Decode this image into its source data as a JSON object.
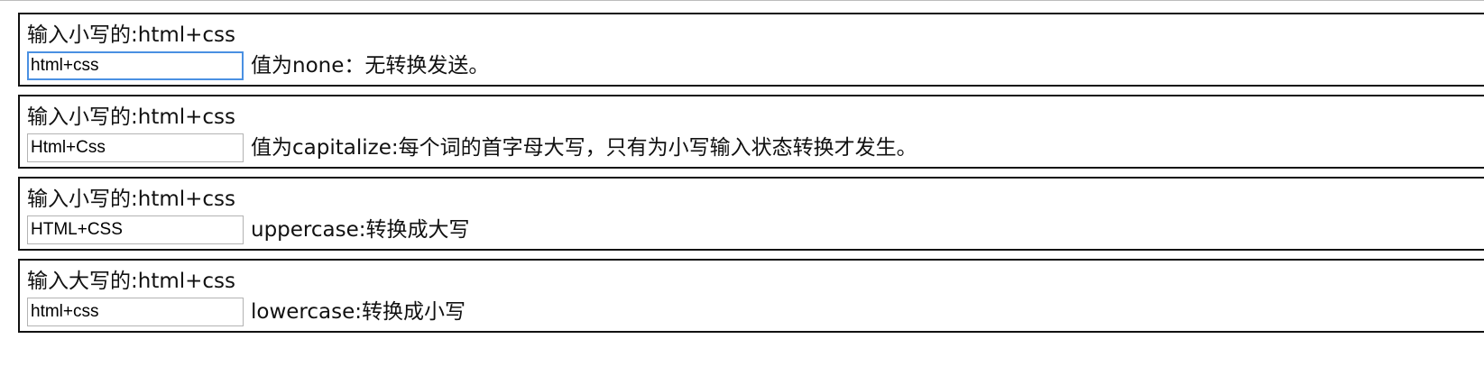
{
  "demos": [
    {
      "label": "输入小写的:html+css",
      "input_value": "html+css",
      "description": "值为none：无转换发送。"
    },
    {
      "label": "输入小写的:html+css",
      "input_value": "Html+Css",
      "description": "值为capitalize:每个词的首字母大写，只有为小写输入状态转换才发生。"
    },
    {
      "label": "输入小写的:html+css",
      "input_value": "HTML+CSS",
      "description": "uppercase:转换成大写"
    },
    {
      "label": "输入大写的:html+css",
      "input_value": "html+css",
      "description": "lowercase:转换成小写"
    }
  ],
  "colors": {
    "border": "#111111",
    "focus": "#4a90e2",
    "input_border": "#b3b3b3"
  }
}
